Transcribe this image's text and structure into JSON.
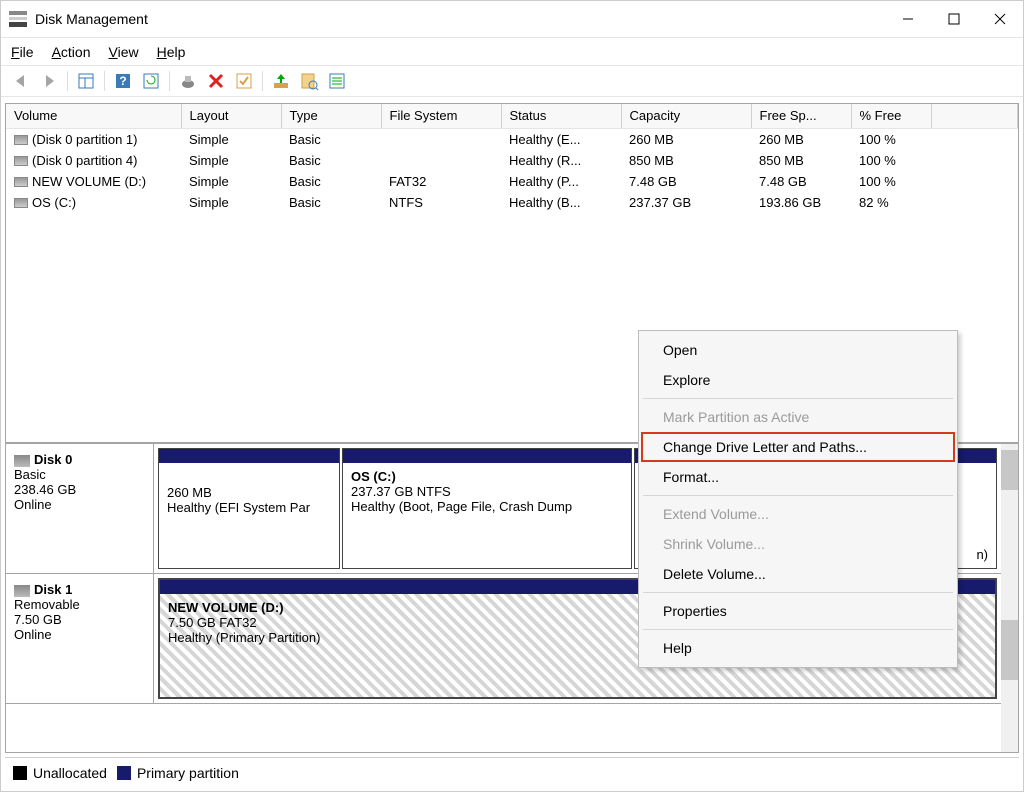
{
  "window": {
    "title": "Disk Management"
  },
  "menu": {
    "file": "File",
    "action": "Action",
    "view": "View",
    "help": "Help"
  },
  "columns": {
    "volume": "Volume",
    "layout": "Layout",
    "type": "Type",
    "fs": "File System",
    "status": "Status",
    "capacity": "Capacity",
    "free": "Free Sp...",
    "pct": "% Free"
  },
  "volumes": [
    {
      "name": "(Disk 0 partition 1)",
      "layout": "Simple",
      "type": "Basic",
      "fs": "",
      "status": "Healthy (E...",
      "capacity": "260 MB",
      "free": "260 MB",
      "pct": "100 %"
    },
    {
      "name": "(Disk 0 partition 4)",
      "layout": "Simple",
      "type": "Basic",
      "fs": "",
      "status": "Healthy (R...",
      "capacity": "850 MB",
      "free": "850 MB",
      "pct": "100 %"
    },
    {
      "name": "NEW VOLUME (D:)",
      "layout": "Simple",
      "type": "Basic",
      "fs": "FAT32",
      "status": "Healthy (P...",
      "capacity": "7.48 GB",
      "free": "7.48 GB",
      "pct": "100 %"
    },
    {
      "name": "OS (C:)",
      "layout": "Simple",
      "type": "Basic",
      "fs": "NTFS",
      "status": "Healthy (B...",
      "capacity": "237.37 GB",
      "free": "193.86 GB",
      "pct": "82 %"
    }
  ],
  "disks": [
    {
      "label": "Disk 0",
      "info1": "Basic",
      "info2": "238.46 GB",
      "info3": "Online",
      "parts": [
        {
          "title": "",
          "line1": "260 MB",
          "line2": "Healthy (EFI System Par"
        },
        {
          "title": "OS  (C:)",
          "line1": "237.37 GB NTFS",
          "line2": "Healthy (Boot, Page File, Crash Dump"
        },
        {
          "title": "",
          "line1": "",
          "line2": "n)"
        }
      ]
    },
    {
      "label": "Disk 1",
      "info1": "Removable",
      "info2": "7.50 GB",
      "info3": "Online",
      "parts": [
        {
          "title": "NEW VOLUME  (D:)",
          "line1": "7.50 GB FAT32",
          "line2": "Healthy (Primary Partition)"
        }
      ]
    }
  ],
  "legend": {
    "unalloc": "Unallocated",
    "primary": "Primary partition"
  },
  "ctx": {
    "open": "Open",
    "explore": "Explore",
    "mark": "Mark Partition as Active",
    "change": "Change Drive Letter and Paths...",
    "format": "Format...",
    "extend": "Extend Volume...",
    "shrink": "Shrink Volume...",
    "delete": "Delete Volume...",
    "props": "Properties",
    "help": "Help"
  }
}
